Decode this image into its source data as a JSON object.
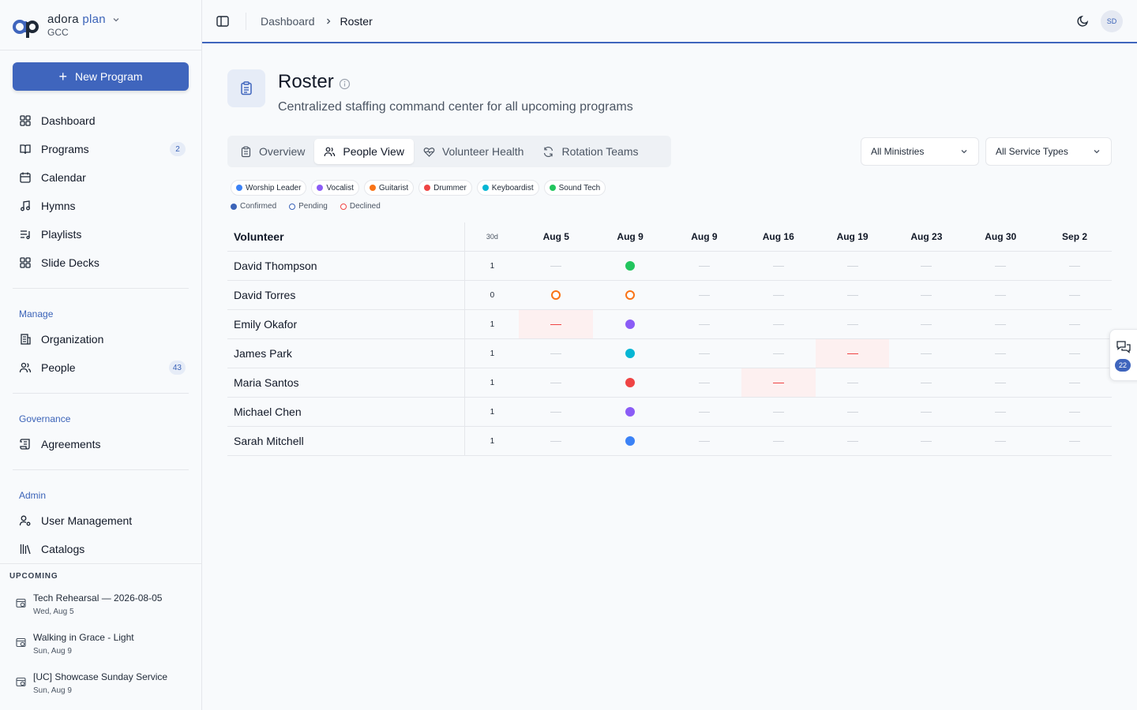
{
  "app": {
    "brand_name": "adora",
    "brand_accent": "plan",
    "org": "GCC"
  },
  "sidebar": {
    "new_button": "New Program",
    "main_nav": [
      {
        "label": "Dashboard",
        "icon": "grid-icon"
      },
      {
        "label": "Programs",
        "icon": "book-icon",
        "badge": "2"
      },
      {
        "label": "Calendar",
        "icon": "calendar-icon"
      },
      {
        "label": "Hymns",
        "icon": "music-icon"
      },
      {
        "label": "Playlists",
        "icon": "playlist-icon"
      },
      {
        "label": "Slide Decks",
        "icon": "grid-icon"
      }
    ],
    "manage_label": "Manage",
    "manage_nav": [
      {
        "label": "Organization",
        "icon": "building-icon"
      },
      {
        "label": "People",
        "icon": "users-icon",
        "badge": "43"
      }
    ],
    "governance_label": "Governance",
    "governance_nav": [
      {
        "label": "Agreements",
        "icon": "scroll-icon"
      }
    ],
    "admin_label": "Admin",
    "admin_nav": [
      {
        "label": "User Management",
        "icon": "user-cog-icon"
      },
      {
        "label": "Catalogs",
        "icon": "library-icon"
      }
    ],
    "upcoming_title": "UPCOMING",
    "upcoming": [
      {
        "title": "Tech Rehearsal — 2026-08-05",
        "date": "Wed, Aug 5"
      },
      {
        "title": "Walking in Grace - Light",
        "date": "Sun, Aug 9"
      },
      {
        "title": "[UC] Showcase Sunday Service",
        "date": "Sun, Aug 9"
      }
    ]
  },
  "header": {
    "breadcrumb_root": "Dashboard",
    "breadcrumb_current": "Roster",
    "avatar_initials": "SD"
  },
  "page": {
    "title": "Roster",
    "subtitle": "Centralized staffing command center for all upcoming programs"
  },
  "tabs": [
    {
      "label": "Overview",
      "icon": "clipboard-icon",
      "active": false
    },
    {
      "label": "People View",
      "icon": "users-icon",
      "active": true
    },
    {
      "label": "Volunteer Health",
      "icon": "heart-pulse-icon",
      "active": false
    },
    {
      "label": "Rotation Teams",
      "icon": "refresh-icon",
      "active": false
    }
  ],
  "filters": {
    "ministries": "All Ministries",
    "service_types": "All Service Types"
  },
  "roles": [
    {
      "label": "Worship Leader",
      "color": "#3b82f6"
    },
    {
      "label": "Vocalist",
      "color": "#8b5cf6"
    },
    {
      "label": "Guitarist",
      "color": "#f97316"
    },
    {
      "label": "Drummer",
      "color": "#ef4444"
    },
    {
      "label": "Keyboardist",
      "color": "#06b6d4"
    },
    {
      "label": "Sound Tech",
      "color": "#22c55e"
    }
  ],
  "statuses": [
    {
      "label": "Confirmed",
      "color": "#3b63b8",
      "style": "filled"
    },
    {
      "label": "Pending",
      "color": "#3b63b8",
      "style": "ring"
    },
    {
      "label": "Declined",
      "color": "#ef4444",
      "style": "ring"
    }
  ],
  "table": {
    "name_header": "Volunteer",
    "count_header": "30d",
    "dates": [
      "Aug 5",
      "Aug 9",
      "Aug 9",
      "Aug 16",
      "Aug 19",
      "Aug 23",
      "Aug 30",
      "Sep 2"
    ],
    "rows": [
      {
        "name": "David Thompson",
        "count": "1",
        "cells": [
          "-",
          "confirmed:#22c55e",
          "-",
          "-",
          "-",
          "-",
          "-",
          "-"
        ]
      },
      {
        "name": "David Torres",
        "count": "0",
        "cells": [
          "pending:#f97316",
          "pending:#f97316",
          "-",
          "-",
          "-",
          "-",
          "-",
          "-"
        ]
      },
      {
        "name": "Emily Okafor",
        "count": "1",
        "cells": [
          "declined",
          "confirmed:#8b5cf6",
          "-",
          "-",
          "-",
          "-",
          "-",
          "-"
        ]
      },
      {
        "name": "James Park",
        "count": "1",
        "cells": [
          "-",
          "confirmed:#06b6d4",
          "-",
          "-",
          "declined",
          "-",
          "-",
          "-"
        ]
      },
      {
        "name": "Maria Santos",
        "count": "1",
        "cells": [
          "-",
          "confirmed:#ef4444",
          "-",
          "declined",
          "-",
          "-",
          "-",
          "-"
        ]
      },
      {
        "name": "Michael Chen",
        "count": "1",
        "cells": [
          "-",
          "confirmed:#8b5cf6",
          "-",
          "-",
          "-",
          "-",
          "-",
          "-"
        ]
      },
      {
        "name": "Sarah Mitchell",
        "count": "1",
        "cells": [
          "-",
          "confirmed:#3b82f6",
          "-",
          "-",
          "-",
          "-",
          "-",
          "-"
        ]
      }
    ]
  },
  "chat_widget": {
    "count": "22"
  }
}
